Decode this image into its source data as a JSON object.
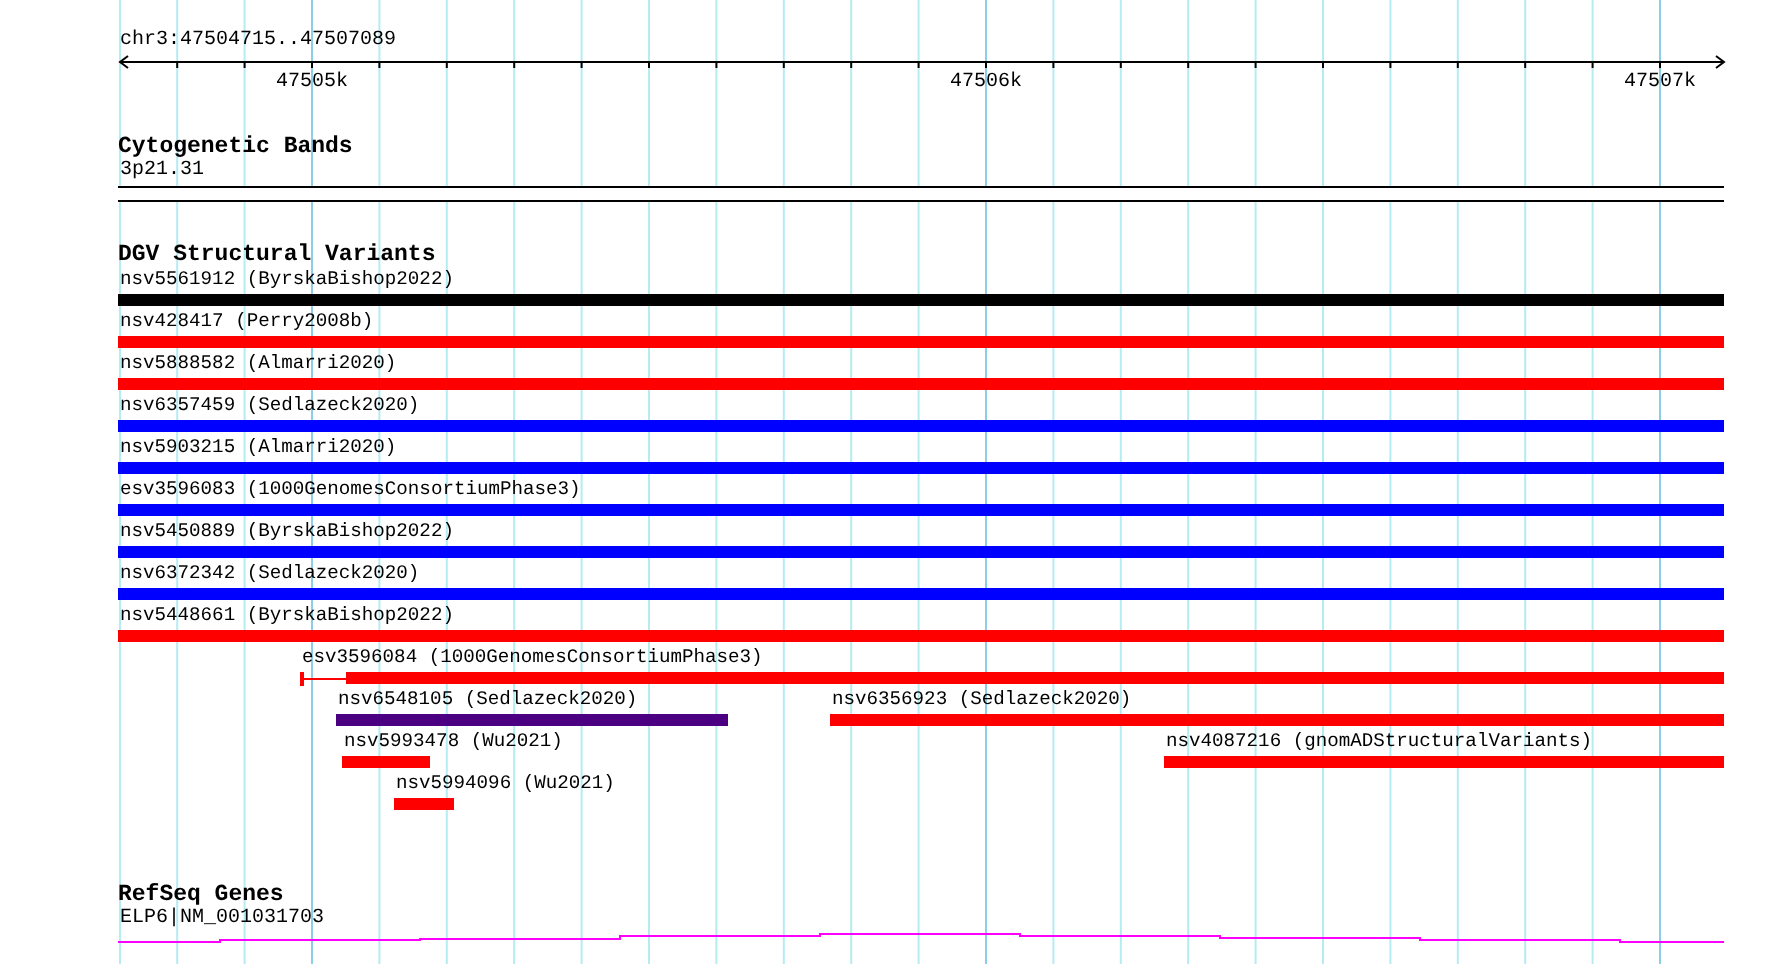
{
  "ruler": {
    "locus": "chr3:47504715..47507089",
    "ticks": [
      "47505k",
      "47506k",
      "47507k"
    ]
  },
  "cytobands": {
    "title": "Cytogenetic Bands",
    "band": "3p21.31"
  },
  "variants": {
    "title": "DGV Structural Variants",
    "features": [
      {
        "label": "nsv5561912 (ByrskaBishop2022)",
        "color": "#000000"
      },
      {
        "label": "nsv428417 (Perry2008b)",
        "color": "#ff0000"
      },
      {
        "label": "nsv5888582 (Almarri2020)",
        "color": "#ff0000"
      },
      {
        "label": "nsv6357459 (Sedlazeck2020)",
        "color": "#0000ff"
      },
      {
        "label": "nsv5903215 (Almarri2020)",
        "color": "#0000ff"
      },
      {
        "label": "esv3596083 (1000GenomesConsortiumPhase3)",
        "color": "#0000ff"
      },
      {
        "label": "nsv5450889 (ByrskaBishop2022)",
        "color": "#0000ff"
      },
      {
        "label": "nsv6372342 (Sedlazeck2020)",
        "color": "#0000ff"
      },
      {
        "label": "nsv5448661 (ByrskaBishop2022)",
        "color": "#ff0000"
      },
      {
        "label": "esv3596084 (1000GenomesConsortiumPhase3)",
        "color": "#ff0000"
      },
      {
        "label": "nsv6548105 (Sedlazeck2020)",
        "color": "#4b0082"
      },
      {
        "label": "nsv6356923 (Sedlazeck2020)",
        "color": "#ff0000"
      },
      {
        "label": "nsv5993478 (Wu2021)",
        "color": "#ff0000"
      },
      {
        "label": "nsv4087216 (gnomADStructuralVariants)",
        "color": "#ff0000"
      },
      {
        "label": "nsv5994096 (Wu2021)",
        "color": "#ff0000"
      }
    ]
  },
  "genes": {
    "title": "RefSeq Genes",
    "transcript": "ELP6|NM_001031703"
  }
}
